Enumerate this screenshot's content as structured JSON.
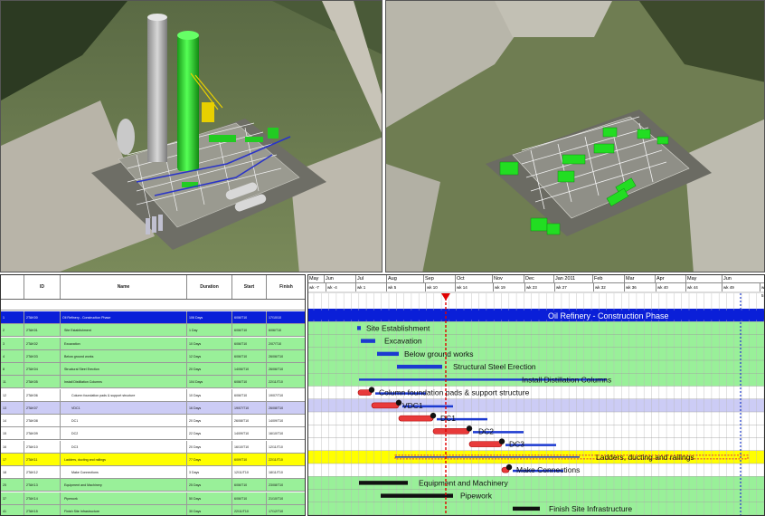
{
  "task_grid": {
    "columns": {
      "num": "",
      "id": "ID",
      "name": "Name",
      "duration": "Duration",
      "start": "Start",
      "finish": "Finish"
    },
    "rows": [
      {
        "num": "1",
        "id": "2TAK00",
        "name": "Oil Refinery - Construction Phase",
        "duration": "106 Days",
        "start": "6/06/T10",
        "finish": "17/10/10",
        "style": "summary"
      },
      {
        "num": "2",
        "id": "2TAK01",
        "name": "Site Establishment",
        "duration": "1 Day",
        "start": "6/06/T10",
        "finish": "6/06/T10",
        "style": "green"
      },
      {
        "num": "3",
        "id": "2TAK02",
        "name": "Excavation",
        "duration": "10 Days",
        "start": "6/06/T10",
        "finish": "2/07/T10",
        "style": "green"
      },
      {
        "num": "4",
        "id": "2TAK03",
        "name": "Below ground works",
        "duration": "12 Days",
        "start": "6/06/T10",
        "finish": "26/06/T10",
        "style": "green"
      },
      {
        "num": "8",
        "id": "2TAK04",
        "name": "Structural Steel Erection",
        "duration": "20 Days",
        "start": "14/06/T10",
        "finish": "26/06/T10",
        "style": "green"
      },
      {
        "num": "11",
        "id": "2TAK05",
        "name": "Install Distillation Columns",
        "duration": "104 Days",
        "start": "6/06/T10",
        "finish": "22/11/T10",
        "style": "green"
      },
      {
        "num": "12",
        "id": "2TAK06",
        "name": "Column foundation pads & support structure",
        "duration": "10 Days",
        "start": "6/06/T10",
        "finish": "19/07/T10",
        "style": "white"
      },
      {
        "num": "13",
        "id": "2TAK07",
        "name": "VDC1",
        "duration": "16 Days",
        "start": "19/07/T10",
        "finish": "26/08/T10",
        "style": "lavender"
      },
      {
        "num": "14",
        "id": "2TAK08",
        "name": "DC1",
        "duration": "20 Days",
        "start": "26/08/T10",
        "finish": "14/09/T10",
        "style": "white"
      },
      {
        "num": "15",
        "id": "2TAK09",
        "name": "DC2",
        "duration": "22 Days",
        "start": "14/09/T10",
        "finish": "16/10/T10",
        "style": "white"
      },
      {
        "num": "16",
        "id": "2TAK10",
        "name": "DC3",
        "duration": "20 Days",
        "start": "16/10/T10",
        "finish": "12/11/T10",
        "style": "white"
      },
      {
        "num": "17",
        "id": "2TAK11",
        "name": "Ladders, ducting and railings",
        "duration": "77 Days",
        "start": "6/09/T10",
        "finish": "22/11/T10",
        "style": "yellow"
      },
      {
        "num": "18",
        "id": "2TAK12",
        "name": "Make Connections",
        "duration": "3 Days",
        "start": "12/11/T10",
        "finish": "18/11/T10",
        "style": "white"
      },
      {
        "num": "25",
        "id": "2TAK13",
        "name": "Equipment and Machinery",
        "duration": "25 Days",
        "start": "6/06/T10",
        "finish": "23/08/T10",
        "style": "green"
      },
      {
        "num": "37",
        "id": "2TAK14",
        "name": "Pipework",
        "duration": "50 Days",
        "start": "6/06/T10",
        "finish": "21/10/T10",
        "style": "green"
      },
      {
        "num": "41",
        "id": "2TAK15",
        "name": "Finish Site Infrastructure",
        "duration": "30 Days",
        "start": "22/11/T10",
        "finish": "17/12/T10",
        "style": "green"
      }
    ]
  },
  "timeline": {
    "months": [
      "May",
      "Jun",
      "Jul",
      "Aug",
      "Sep",
      "Oct",
      "Nov",
      "Dec",
      "Jan 2011",
      "Feb",
      "Mar",
      "Apr",
      "May",
      "Jun"
    ],
    "weeks": [
      "wk -7",
      "wk -4",
      "wk 1",
      "wk 5",
      "wk 10",
      "wk 14",
      "wk 19",
      "wk 23",
      "wk 27",
      "wk 32",
      "wk 36",
      "wk 40",
      "wk 44",
      "wk 49",
      "wk 5"
    ]
  },
  "gantt_labels": {
    "project": "Oil Refinery - Construction Phase",
    "site": "Site Establishment",
    "excavation": "Excavation",
    "below": "Below ground works",
    "steel": "Structural Steel Erection",
    "install": "Install Distillation Columns",
    "column": "Column foundation pads & support structure",
    "vdc1": "VDC1",
    "dc1": "DC1",
    "dc2": "DC2",
    "dc3": "DC3",
    "ladders": "Ladders, ducting and railings",
    "connections": "Make Connections",
    "equipment": "Equipment and Machinery",
    "pipework": "Pipework",
    "finish": "Finish Site Infrastructure"
  },
  "colors": {
    "summary": "#0a1fd8",
    "green": "#99f099",
    "yellow": "#ffff00",
    "lavender": "#ccccf5",
    "today_line": "#e00000",
    "bar_blue": "#1c3ad0",
    "bar_red": "#e83a3a"
  }
}
